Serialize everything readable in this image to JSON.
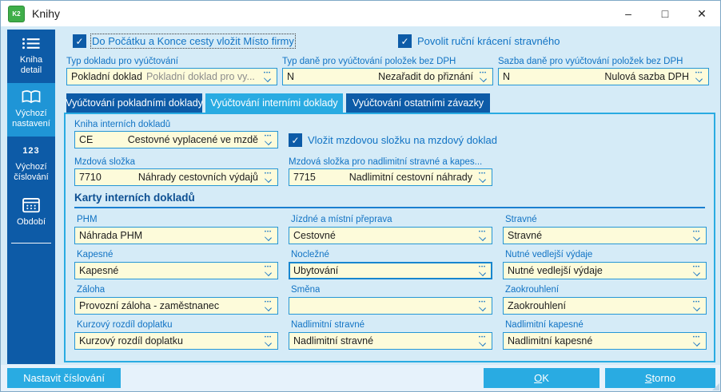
{
  "window": {
    "title": "Knihy",
    "logo_text": "K2",
    "controls": {
      "minimize": "–",
      "maximize": "□",
      "close": "✕"
    }
  },
  "colors": {
    "accent_dark_blue": "#0d5ba7",
    "active_cyan": "#29abe2",
    "sidebar_active": "#1f95d6",
    "content_bg": "#d5ebf7",
    "field_bg": "#fdfbda",
    "field_border": "#2596d6",
    "label_blue": "#1173c4"
  },
  "sidebar": {
    "items": [
      {
        "label": "Kniha detail",
        "icon": "list-icon",
        "active": false
      },
      {
        "label": "Výchozí nastavení",
        "icon": "book-icon",
        "active": true
      },
      {
        "label": "Výchozí číslování",
        "icon": "numbers-icon",
        "icon_text": "123",
        "active": false
      },
      {
        "label": "Období",
        "icon": "calendar-icon",
        "active": false
      }
    ]
  },
  "header": {
    "checkbox1": "Do Počátku a Konce cesty vložit Místo firmy",
    "checkbox2": "Povolit ruční krácení stravného",
    "fields": [
      {
        "label": "Typ dokladu pro vyúčtování",
        "value": "Pokladní doklad",
        "value2": "Pokladní doklad pro vy..."
      },
      {
        "label": "Typ daně pro vyúčtování položek bez DPH",
        "value": "N",
        "value2": "Nezařadit do přiznání"
      },
      {
        "label": "Sazba daně pro vyúčtování položek bez DPH",
        "value": "N",
        "value2": "Nulová sazba DPH"
      }
    ]
  },
  "tabs": [
    {
      "label": "Vyúčtování pokladními doklady",
      "active": false
    },
    {
      "label": "Vyúčtování interními doklady",
      "active": true
    },
    {
      "label": "Vyúčtování ostatními závazky",
      "active": false
    }
  ],
  "panel": {
    "book_field": {
      "label": "Kniha interních dokladů",
      "value": "CE",
      "value2": "Cestovné vyplacené ve mzdě"
    },
    "checkbox": "Vložit mzdovou složku na mzdový doklad",
    "wage_fields": [
      {
        "label": "Mzdová složka",
        "value": "7710",
        "value2": "Náhrady cestovních výdajů"
      },
      {
        "label": "Mzdová složka pro nadlimitní stravné a kapes...",
        "value": "7715",
        "value2": "Nadlimitní cestovní náhrady"
      }
    ],
    "section_title": "Karty interních dokladů",
    "grid": [
      {
        "label": "PHM",
        "value": "Náhrada PHM"
      },
      {
        "label": "Jízdné a místní přeprava",
        "value": "Cestovné"
      },
      {
        "label": "Stravné",
        "value": "Stravné"
      },
      {
        "label": "Kapesné",
        "value": "Kapesné"
      },
      {
        "label": "Nocležné",
        "value": "Ubytování"
      },
      {
        "label": "Nutné vedlejší výdaje",
        "value": "Nutné vedlejší výdaje"
      },
      {
        "label": "Záloha",
        "value": "Provozní záloha - zaměstnanec"
      },
      {
        "label": "Směna",
        "value": ""
      },
      {
        "label": "Zaokrouhlení",
        "value": "Zaokrouhlení"
      },
      {
        "label": "Kurzový rozdíl doplatku",
        "value": "Kurzový rozdíl doplatku"
      },
      {
        "label": "Nadlimitní stravné",
        "value": "Nadlimitní stravné"
      },
      {
        "label": "Nadlimitní kapesné",
        "value": "Nadlimitní kapesné"
      }
    ]
  },
  "footer": {
    "settings_button": "Nastavit číslování",
    "ok_button": "OK",
    "cancel_button": "Storno"
  }
}
